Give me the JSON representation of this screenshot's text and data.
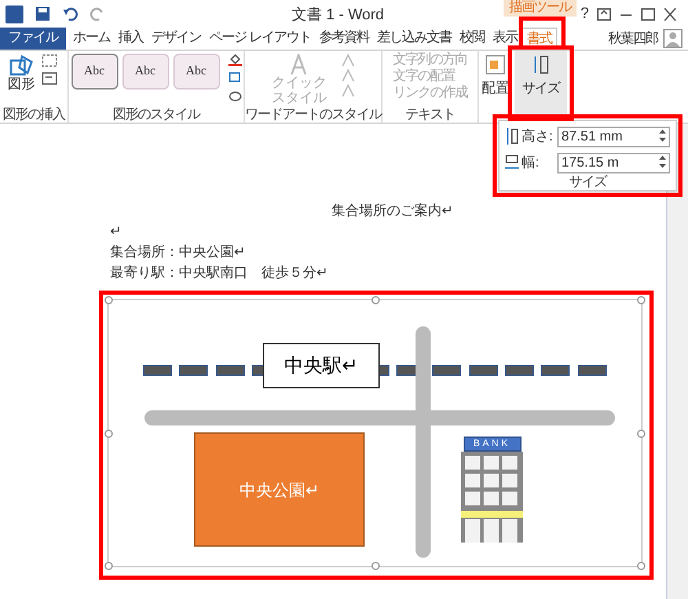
{
  "title_bar": {
    "title": "文書 1 - Word",
    "context_label": "描画ツール",
    "help": "?"
  },
  "tabs": [
    {
      "label": "ファイル",
      "kind": "file",
      "selected": false
    },
    {
      "label": "ホーム",
      "kind": "tab",
      "selected": false
    },
    {
      "label": "挿入",
      "kind": "tab",
      "selected": false
    },
    {
      "label": "デザイン",
      "kind": "tab",
      "selected": false
    },
    {
      "label": "ページ レイアウト",
      "kind": "tab",
      "selected": false
    },
    {
      "label": "参考資料",
      "kind": "tab",
      "selected": false
    },
    {
      "label": "差し込み文書",
      "kind": "tab",
      "selected": false
    },
    {
      "label": "校閲",
      "kind": "tab",
      "selected": false
    },
    {
      "label": "表示",
      "kind": "tab",
      "selected": false
    },
    {
      "label": "書式",
      "kind": "tab",
      "selected": true
    }
  ],
  "user": {
    "name": "秋葉四郎"
  },
  "insert_shapes": {
    "button": "図形",
    "label": "図形の挿入"
  },
  "shape_styles": {
    "thumbnails": [
      "Abc",
      "Abc",
      "Abc"
    ],
    "label": "図形のスタイル"
  },
  "wordart": {
    "disabled": true,
    "quick_style": "クイックスタイル",
    "label": "ワードアートのスタイル"
  },
  "text_group": {
    "disabled": true,
    "items": [
      "文字列の方向",
      "文字の配置",
      "リンクの作成"
    ],
    "label": "テキスト"
  },
  "arrange": {
    "button": "配置"
  },
  "size": {
    "button": "サイズ"
  },
  "size_panel": {
    "height_label": "高さ:",
    "height_value": "87.51 mm",
    "width_label": "幅:",
    "width_value": "175.15 m",
    "label": "サイズ"
  },
  "document": {
    "heading": "集合場所のご案内↵",
    "lines": [
      "↵",
      "集合場所：中央公園↵",
      "最寄り駅：中央駅南口　徒歩５分↵"
    ]
  },
  "map": {
    "station": "中央駅↵",
    "park": "中央公園↵",
    "bank_sign": "BANK"
  }
}
